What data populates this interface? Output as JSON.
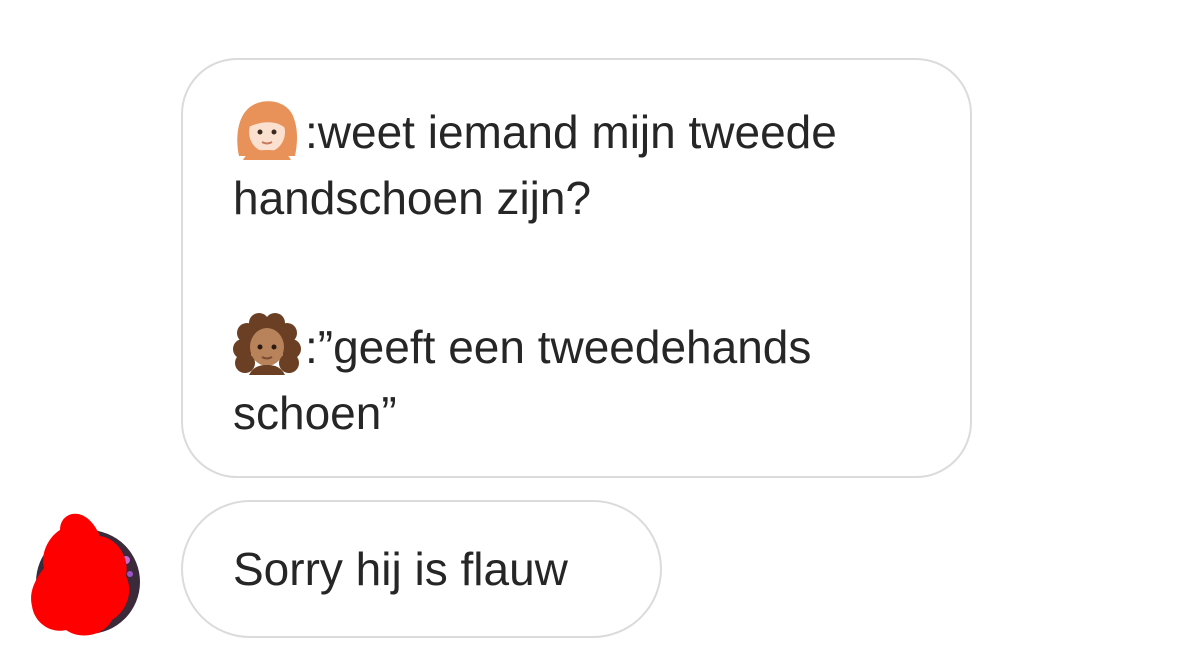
{
  "conversation": {
    "messages": [
      {
        "lines": [
          {
            "speaker_emoji": "woman-red-hair-emoji",
            "text": ":weet iemand mijn tweede"
          },
          {
            "text": "handschoen zijn?"
          },
          {
            "speaker_emoji": "woman-curly-hair-emoji",
            "text": ":”geeft een tweedehands"
          },
          {
            "text": "schoen”"
          }
        ]
      },
      {
        "text": "Sorry hij is flauw"
      }
    ]
  },
  "colors": {
    "bubble_border": "#dbdbdb",
    "text": "#262626",
    "redaction": "#ff0000"
  }
}
